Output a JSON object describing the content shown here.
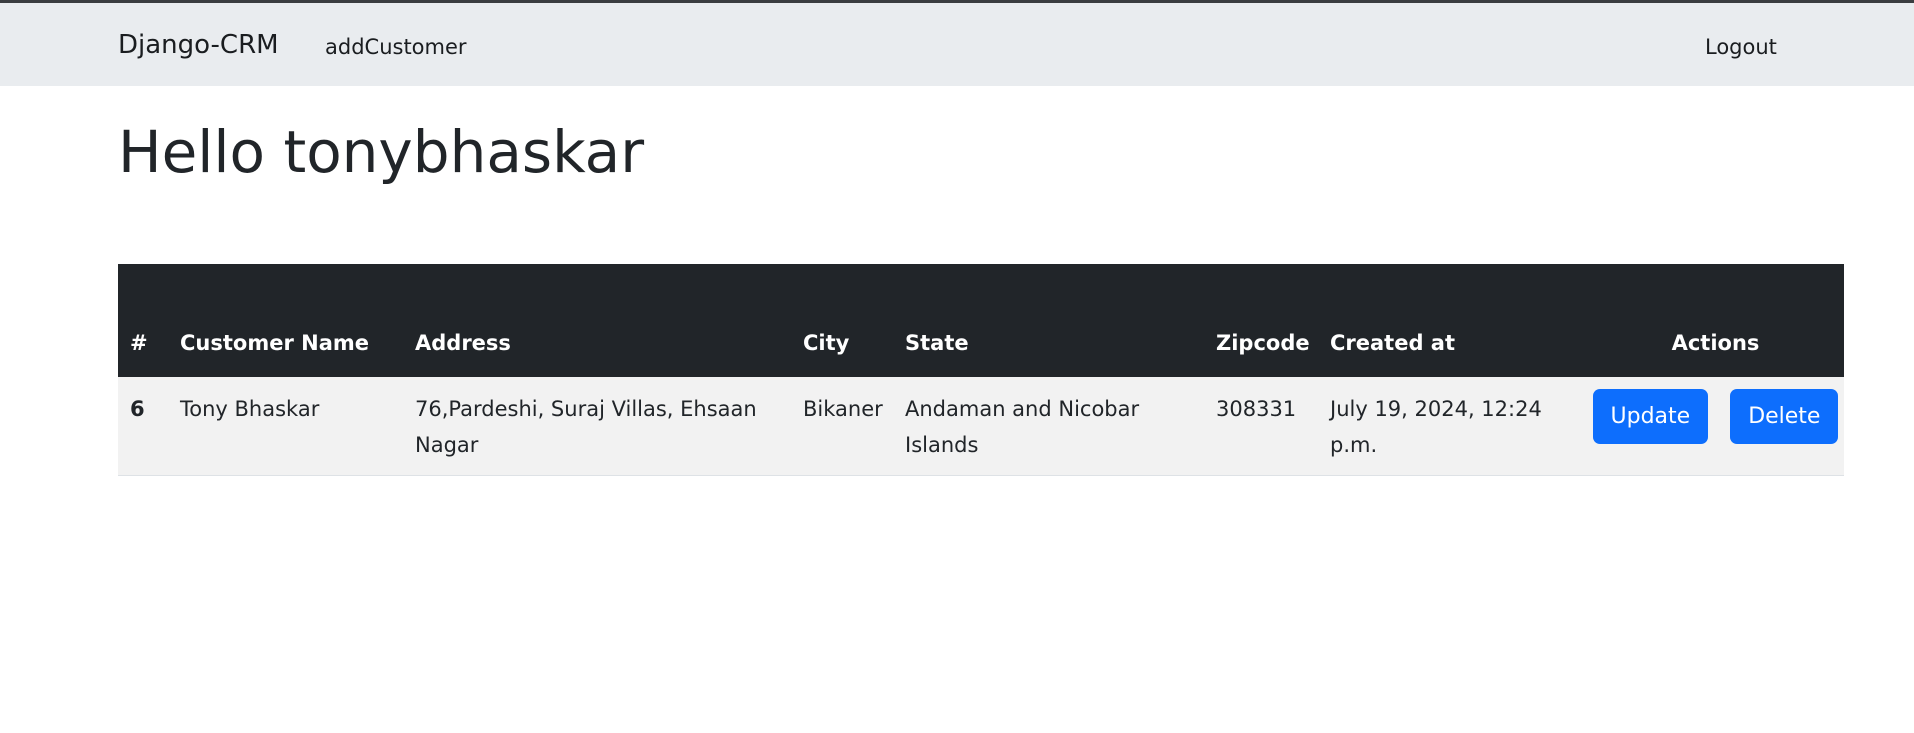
{
  "navbar": {
    "brand": "Django-CRM",
    "links": [
      "addCustomer"
    ],
    "logout": "Logout"
  },
  "greeting": "Hello tonybhaskar",
  "table": {
    "headers": {
      "num": "#",
      "name": "Customer Name",
      "address": "Address",
      "city": "City",
      "state": "State",
      "zipcode": "Zipcode",
      "created": "Created at",
      "actions": "Actions"
    },
    "rows": [
      {
        "num": "6",
        "name": "Tony Bhaskar",
        "address": "76,Pardeshi, Suraj Villas, Ehsaan Nagar",
        "city": "Bikaner",
        "state": "Andaman and Nicobar Islands",
        "zipcode": "308331",
        "created": "July 19, 2024, 12:24 p.m.",
        "update_label": "Update",
        "delete_label": "Delete"
      }
    ]
  },
  "colors": {
    "navbar_bg": "#e9ecef",
    "table_header_bg": "#212529",
    "row_bg": "#f2f2f2",
    "button_primary": "#0d6efd"
  }
}
